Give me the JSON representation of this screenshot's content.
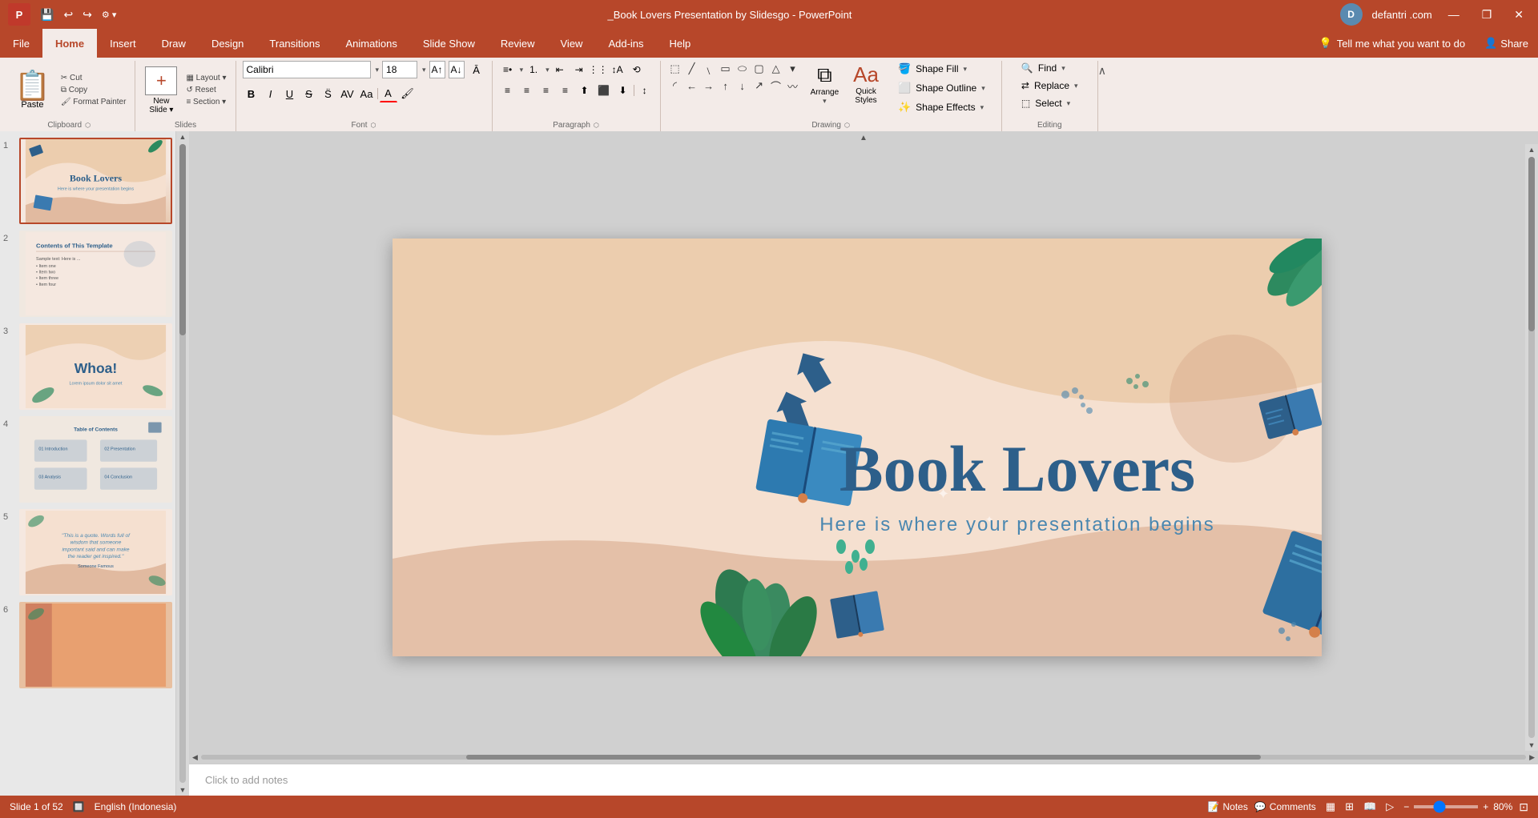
{
  "titlebar": {
    "doc_title": "_Book Lovers Presentation by Slidesgo - PowerPoint",
    "user_name": "defantri .com",
    "save_label": "💾",
    "undo_label": "↩",
    "redo_label": "↪",
    "customize_label": "⚙",
    "minimize": "—",
    "restore": "❐",
    "close": "✕"
  },
  "tabs": {
    "items": [
      "File",
      "Home",
      "Insert",
      "Draw",
      "Design",
      "Transitions",
      "Animations",
      "Slide Show",
      "Review",
      "View",
      "Add-ins",
      "Help"
    ]
  },
  "ribbon": {
    "search_placeholder": "Tell me what you want to do",
    "share_label": "Share",
    "clipboard_label": "Clipboard",
    "slides_label": "Slides",
    "font_label": "Font",
    "paragraph_label": "Paragraph",
    "drawing_label": "Drawing",
    "editing_label": "Editing",
    "paste_label": "Paste",
    "new_slide_label": "New\nSlide",
    "layout_label": "Layout",
    "reset_label": "Reset",
    "section_label": "Section",
    "font_name": "Calibri",
    "font_size": "18",
    "arrange_label": "Arrange",
    "quick_styles_label": "Quick\nStyles",
    "shape_fill_label": "Shape Fill",
    "shape_outline_label": "Shape Outline",
    "shape_effects_label": "Shape Effects",
    "find_label": "Find",
    "replace_label": "Replace",
    "select_label": "Select"
  },
  "slides": {
    "current": 1,
    "total": 52,
    "items": [
      {
        "num": 1,
        "label": "Book Lovers slide 1",
        "active": true
      },
      {
        "num": 2,
        "label": "Contents slide"
      },
      {
        "num": 3,
        "label": "Whoa slide"
      },
      {
        "num": 4,
        "label": "Table of Contents slide"
      },
      {
        "num": 5,
        "label": "Quote slide"
      },
      {
        "num": 6,
        "label": "Orange slide"
      }
    ]
  },
  "main_slide": {
    "title": "Book Lovers",
    "subtitle": "Here is where your presentation begins"
  },
  "notes_placeholder": "Click to add notes",
  "status": {
    "slide_info": "Slide 1 of 52",
    "language": "English (Indonesia)",
    "notes_label": "Notes",
    "comments_label": "Comments",
    "zoom_level": "80%"
  },
  "icons": {
    "save": "💾",
    "undo": "↩",
    "redo": "↪",
    "notes": "📝",
    "comments": "💬",
    "normal_view": "▦",
    "slide_sorter": "⊞",
    "reading_view": "📖",
    "slideshow": "▷",
    "search": "🔍",
    "lightbulb": "💡"
  }
}
